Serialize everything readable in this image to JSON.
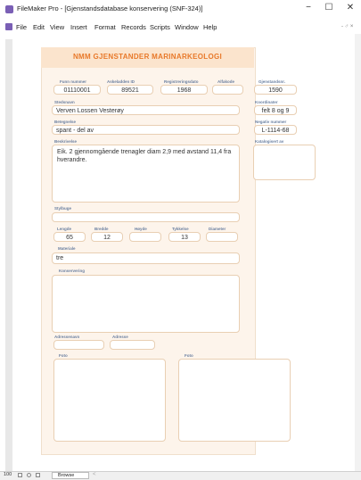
{
  "window": {
    "title": "FileMaker Pro - [Gjenstandsdatabase konservering (SNF-324)]",
    "minimize": "−",
    "maximize": "☐",
    "close": "✕"
  },
  "menu": {
    "items": [
      "File",
      "Edit",
      "View",
      "Insert",
      "Format",
      "Records",
      "Scripts",
      "Window",
      "Help"
    ],
    "mdi_controls": "- ♂ ×"
  },
  "form": {
    "title": "NMM GJENSTANDER MARINARKEOLOGI",
    "fields": {
      "funnnummer": {
        "label": "Funn nummer",
        "value": "01110001"
      },
      "askeladden": {
        "label": "Askeladden ID",
        "value": "89521"
      },
      "registreringsdato": {
        "label": "Registreringsdato",
        "value": "1968"
      },
      "alfakode": {
        "label": "Alfakode",
        "value": ""
      },
      "gjenstandsnr": {
        "label": "Gjenstandsnr.",
        "value": "1590"
      },
      "stedsnavn": {
        "label": "Stedsnavn",
        "value": "Verven Lossen Vesterøy"
      },
      "koordinater": {
        "label": "Koordinater",
        "value": "felt 8 og 9"
      },
      "betegnelse": {
        "label": "Betegnelse",
        "value": "spant - del av"
      },
      "negativnummer": {
        "label": "Negativ nummer",
        "value": "L-1114-68"
      },
      "beskrivelse": {
        "label": "Beskrivelse",
        "value": "Eik. 2 gjennomgående trenagler diam 2,9 med avstand 11,4 fra hverandre."
      },
      "katalogisert": {
        "label": "Katalogisert av",
        "value": ""
      },
      "stylbuge": {
        "label": "Stylbuge",
        "value": ""
      },
      "lengde": {
        "label": "Lengde",
        "value": "65"
      },
      "bredde": {
        "label": "Bredde",
        "value": "12"
      },
      "hoyde": {
        "label": "Høyde",
        "value": ""
      },
      "tykkelse": {
        "label": "Tykkelse",
        "value": "13"
      },
      "diameter": {
        "label": "Diameter",
        "value": ""
      },
      "materiale": {
        "label": "Materiale",
        "value": "tre"
      },
      "konservering": {
        "label": "Konservering",
        "value": ""
      },
      "adressenavn": {
        "label": "Adressenavn",
        "value": ""
      },
      "adresse": {
        "label": "Adresse",
        "value": ""
      },
      "foto1": {
        "label": "Foto"
      },
      "foto2": {
        "label": "Foto"
      }
    }
  },
  "status": {
    "zoom": "100",
    "mode": "Browse",
    "arrow": "<"
  }
}
